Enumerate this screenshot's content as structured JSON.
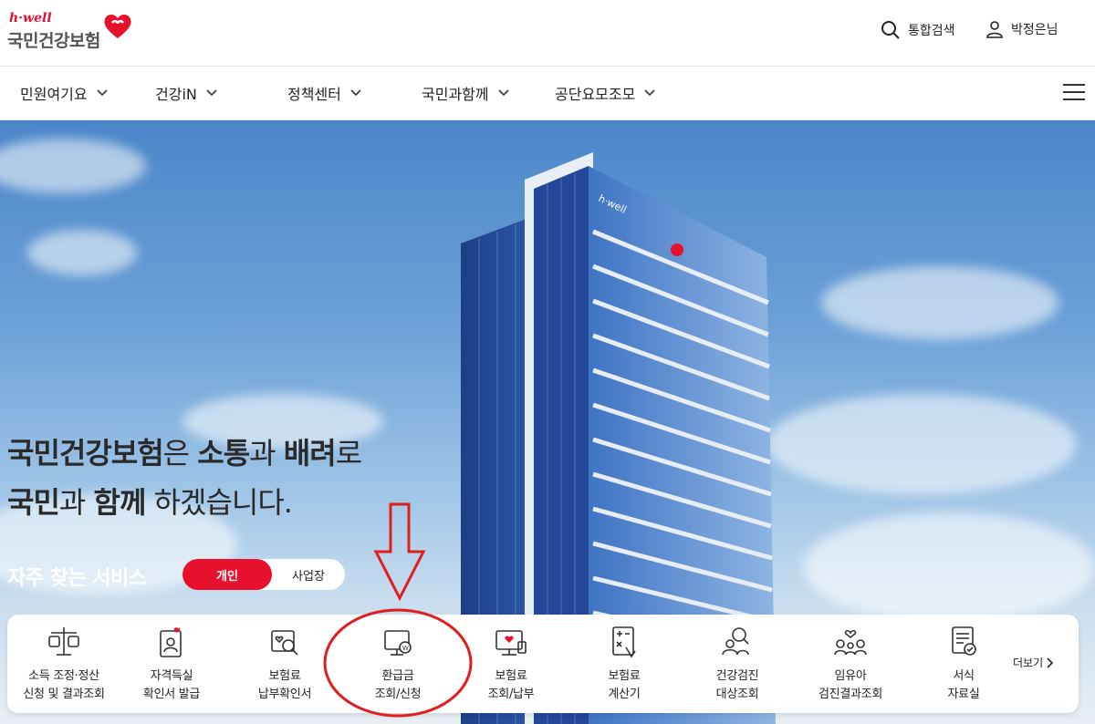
{
  "header": {
    "logo_tagline": "h·well",
    "logo_name": "국민건강보험",
    "search_label": "통합검색",
    "user_label": "박정은님"
  },
  "nav": {
    "items": [
      {
        "label": "민원여기요"
      },
      {
        "label": "건강iN"
      },
      {
        "label": "정책센터"
      },
      {
        "label": "국민과함께"
      },
      {
        "label": "공단요모조모"
      }
    ]
  },
  "hero": {
    "line1_a": "국민건강보험",
    "line1_b": "은 ",
    "line1_c": "소통",
    "line1_d": "과 ",
    "line1_e": "배려",
    "line1_f": "로",
    "line2_a": "국민",
    "line2_b": "과 ",
    "line2_c": "함께",
    "line2_d": " 하겠습니다."
  },
  "favorites": {
    "title": "자주 찾는 서비스",
    "toggle_personal": "개인",
    "toggle_business": "사업장",
    "more_label": "더보기",
    "services": [
      {
        "label": "소득 조정·정산\n신청 및 결과조회",
        "icon": "scale-icon"
      },
      {
        "label": "자격득실\n확인서 발급",
        "icon": "id-card-icon"
      },
      {
        "label": "보험료\n납부확인서",
        "icon": "document-search-icon"
      },
      {
        "label": "환급금\n조회/신청",
        "icon": "refund-monitor-icon"
      },
      {
        "label": "보험료\n조회/납부",
        "icon": "payment-monitor-icon"
      },
      {
        "label": "보험료\n계산기",
        "icon": "calculator-icon"
      },
      {
        "label": "건강검진\n대상조회",
        "icon": "people-search-icon"
      },
      {
        "label": "임유아\n검진결과조회",
        "icon": "family-icon"
      },
      {
        "label": "서식\n자료실",
        "icon": "form-document-icon"
      }
    ]
  },
  "colors": {
    "brand_red": "#e8112d",
    "annotation_red": "#e21d1d"
  }
}
